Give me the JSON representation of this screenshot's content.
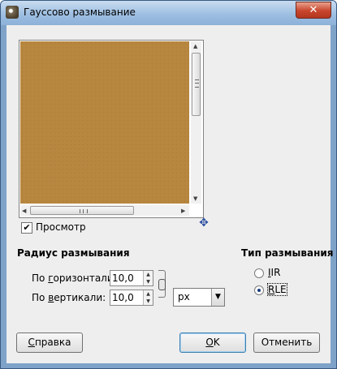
{
  "window": {
    "title": "Гауссово размывание",
    "close_label": "✕"
  },
  "preview": {
    "color": "#b8873f",
    "show_checkbox": {
      "label": "Просмотр",
      "checked": true
    }
  },
  "blur_radius": {
    "section_title": "Радиус размывания",
    "horizontal": {
      "label_pre": "По ",
      "label_mnemonic": "г",
      "label_post": "оризонтали:",
      "value": "10,0"
    },
    "vertical": {
      "label_pre": "По ",
      "label_mnemonic": "в",
      "label_post": "ертикали:",
      "value": "10,0"
    },
    "unit": "px",
    "chained": true
  },
  "blur_type": {
    "section_title": "Тип размывания",
    "options": [
      {
        "mnemonic": "I",
        "rest": "IR",
        "checked": false
      },
      {
        "mnemonic": "R",
        "rest": "LE",
        "checked": true
      }
    ]
  },
  "buttons": {
    "help": {
      "mnemonic": "С",
      "rest": "правка"
    },
    "ok": {
      "mnemonic": "O",
      "rest": "K"
    },
    "cancel": {
      "label": "Отменить"
    }
  },
  "icons": {
    "app": "gimp-icon",
    "navigate": "navigate-icon",
    "chain": "chain-link-icon"
  }
}
